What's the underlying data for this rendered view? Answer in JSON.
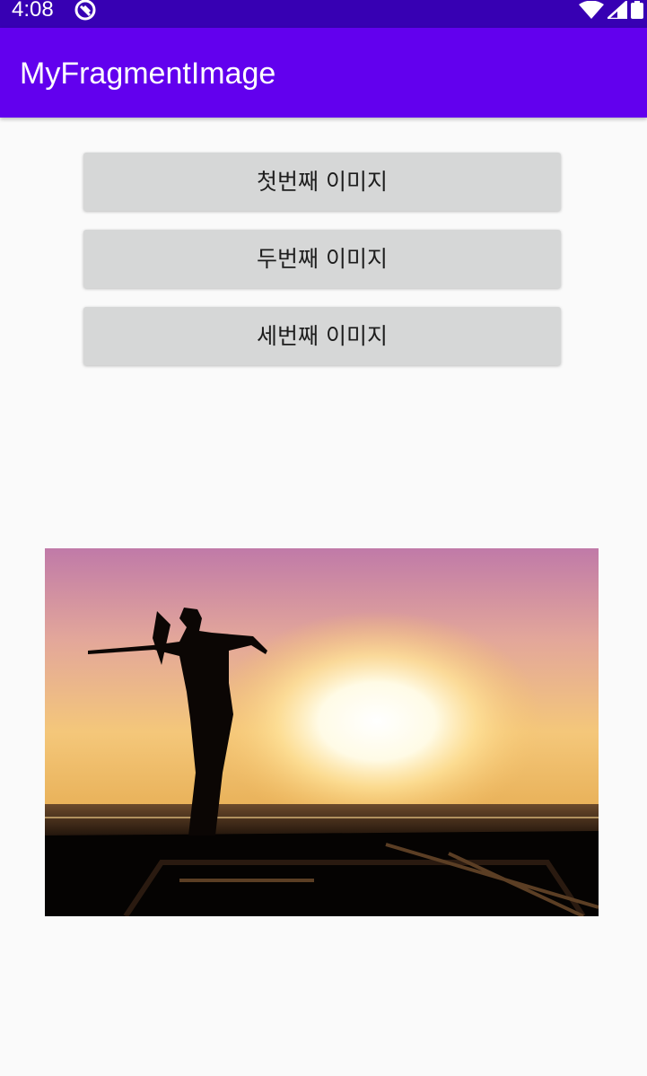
{
  "status_bar": {
    "time": "4:08"
  },
  "app_bar": {
    "title": "MyFragmentImage"
  },
  "buttons": {
    "first_label": "첫번째 이미지",
    "second_label": "두번째 이미지",
    "third_label": "세번째 이미지"
  },
  "colors": {
    "status_bar": "#3700b3",
    "app_bar": "#6200ee",
    "button": "#d6d7d7",
    "background": "#fafafa"
  }
}
